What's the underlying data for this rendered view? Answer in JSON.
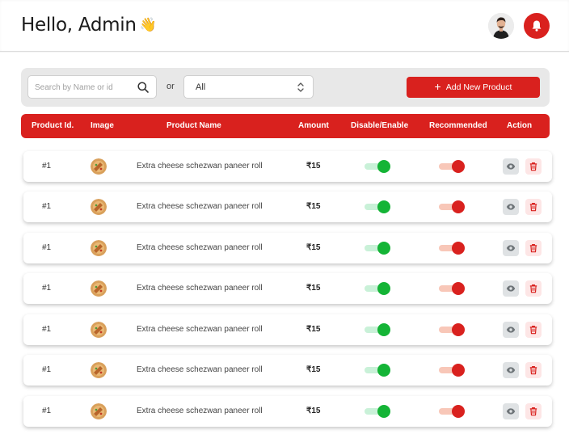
{
  "header": {
    "greeting": "Hello, Admin",
    "wave_emoji": "👋",
    "avatar_icon": "user-avatar",
    "bell_icon": "bell-icon"
  },
  "toolbar": {
    "search_placeholder": "Search by Name or id",
    "search_value": "",
    "or_label": "or",
    "filter_selected": "All",
    "add_label": "Add New Product",
    "add_icon": "+"
  },
  "table": {
    "columns": [
      "Product Id.",
      "Image",
      "Product Name",
      "Amount",
      "Disable/Enable",
      "Recommended",
      "Action"
    ],
    "rows": [
      {
        "id": "#1",
        "name": "Extra cheese schezwan paneer roll",
        "amount": "₹15",
        "enabled": true,
        "recommended": true
      },
      {
        "id": "#1",
        "name": "Extra cheese schezwan paneer roll",
        "amount": "₹15",
        "enabled": true,
        "recommended": true
      },
      {
        "id": "#1",
        "name": "Extra cheese schezwan paneer roll",
        "amount": "₹15",
        "enabled": true,
        "recommended": true
      },
      {
        "id": "#1",
        "name": "Extra cheese schezwan paneer roll",
        "amount": "₹15",
        "enabled": true,
        "recommended": true
      },
      {
        "id": "#1",
        "name": "Extra cheese schezwan paneer roll",
        "amount": "₹15",
        "enabled": true,
        "recommended": true
      },
      {
        "id": "#1",
        "name": "Extra cheese schezwan paneer roll",
        "amount": "₹15",
        "enabled": true,
        "recommended": true
      },
      {
        "id": "#1",
        "name": "Extra cheese schezwan paneer roll",
        "amount": "₹15",
        "enabled": true,
        "recommended": true
      }
    ]
  },
  "colors": {
    "accent": "#d9211e",
    "enabled_green": "#14b436",
    "toolbar_bg": "#e8e8e8"
  }
}
